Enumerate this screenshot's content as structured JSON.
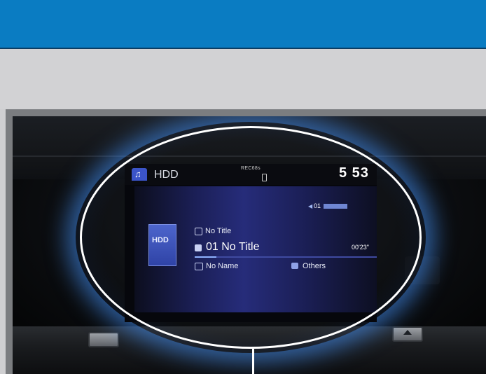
{
  "screen": {
    "source": "HDD",
    "rec_status": "REC68s",
    "clock": "5 53",
    "volume": "01",
    "album_art_label": "HDD",
    "album_title": "No Title",
    "track": "01  No Title",
    "elapsed": "00'23\"",
    "progress_fraction": 0.12,
    "artist": "No Name",
    "genre": "Others"
  },
  "colors": {
    "header_band": "#0a7cc2",
    "callout": "#ffffff",
    "glow": "#4696ff"
  },
  "icons": {
    "source_tab": "music-note-icon",
    "phone": "phone-icon",
    "volume": "volume-icon",
    "album": "folder-icon",
    "track": "track-icon",
    "artist": "artist-icon",
    "genre": "genre-icon"
  }
}
